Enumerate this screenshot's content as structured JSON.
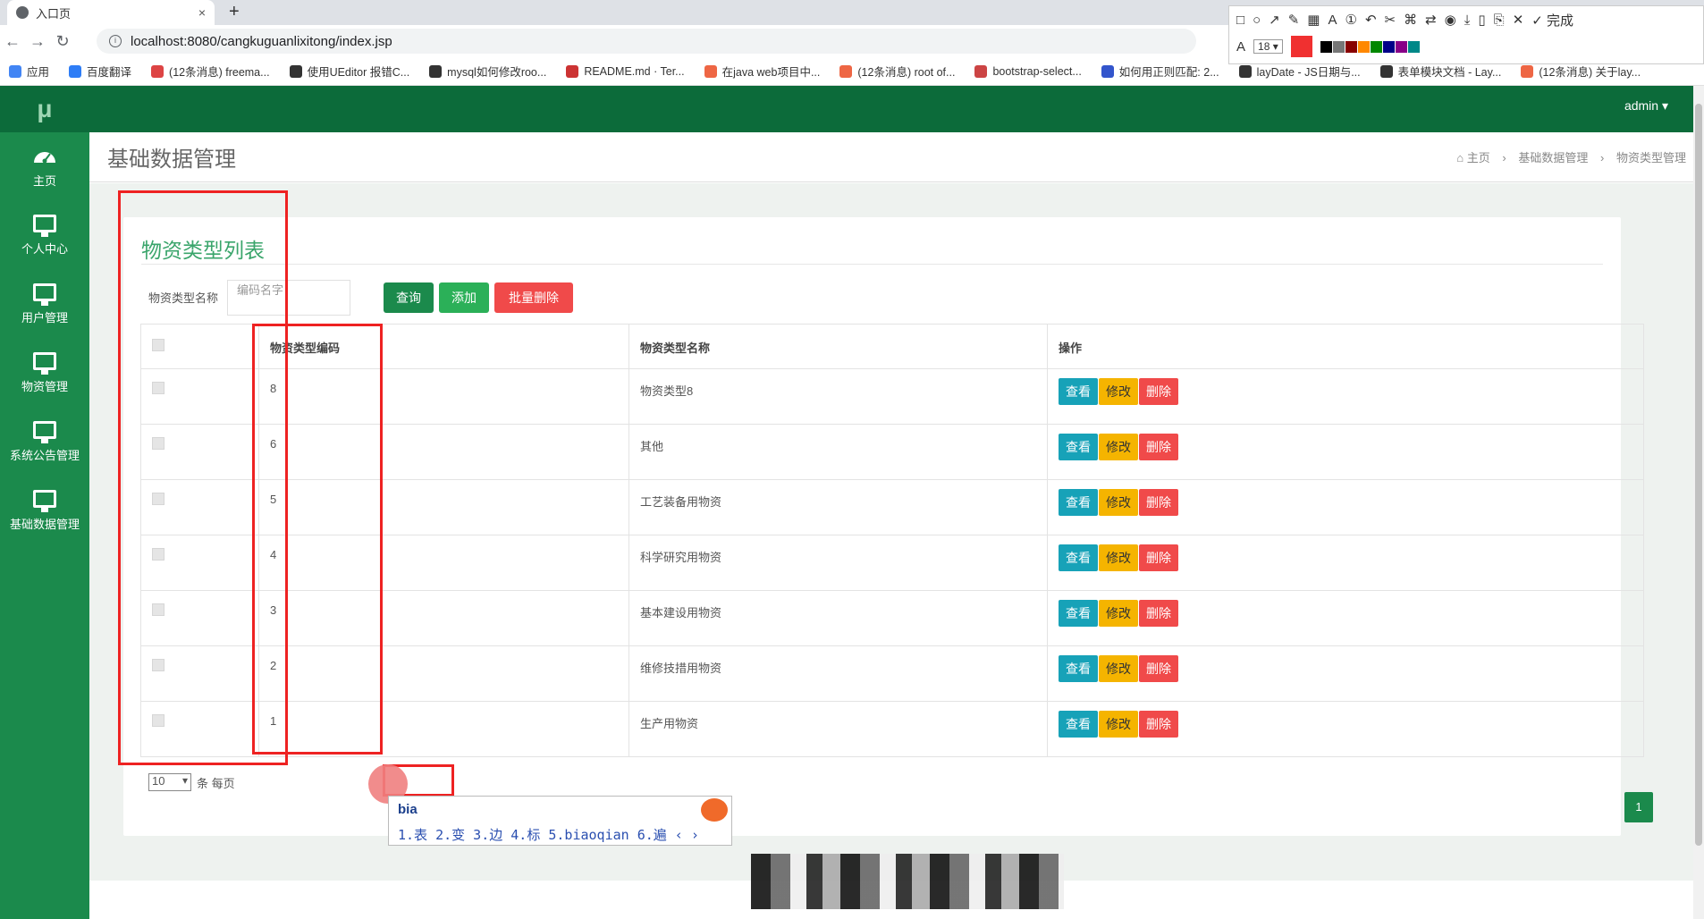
{
  "browser": {
    "tab_title": "入口页",
    "tab_close": "×",
    "new_tab": "+",
    "url": "localhost:8080/cangkuguanlixitong/index.jsp",
    "bookmarks": [
      "应用",
      "百度翻译",
      "(12条消息) freema...",
      "使用UEditor 报错C...",
      "mysql如何修改roo...",
      "README.md · Ter...",
      "在java web项目中...",
      "(12条消息) root of...",
      "bootstrap-select...",
      "如何用正则匹配: 2...",
      "layDate - JS日期与...",
      "表单模块文档 - Lay...",
      "(12条消息) 关于lay..."
    ]
  },
  "snaptool": {
    "font_size": "18",
    "done": "完成"
  },
  "app": {
    "logo": "μ",
    "user": "admin ▾",
    "nav": [
      "主页",
      "个人中心",
      "用户管理",
      "物资管理",
      "系统公告管理",
      "基础数据管理"
    ],
    "page_title": "基础数据管理",
    "breadcrumb": [
      "主页",
      "基础数据管理",
      "物资类型管理"
    ]
  },
  "card": {
    "title": "物资类型列表",
    "search_label": "物资类型名称",
    "search_placeholder": "编码名字",
    "btn_query": "查询",
    "btn_add": "添加",
    "btn_batch_delete": "批量删除"
  },
  "table": {
    "headers": [
      "物资类型编码",
      "物资类型名称",
      "操作"
    ],
    "rows": [
      {
        "code": "8",
        "name": "物资类型8"
      },
      {
        "code": "6",
        "name": "其他"
      },
      {
        "code": "5",
        "name": "工艺装备用物资"
      },
      {
        "code": "4",
        "name": "科学研究用物资"
      },
      {
        "code": "3",
        "name": "基本建设用物资"
      },
      {
        "code": "2",
        "name": "维修技措用物资"
      },
      {
        "code": "1",
        "name": "生产用物资"
      }
    ],
    "op_view": "查看",
    "op_edit": "修改",
    "op_delete": "删除"
  },
  "pagination": {
    "per_page_value": "10",
    "per_page_suffix": "条 每页",
    "current_page": "1"
  },
  "ime": {
    "code": "bia",
    "candidates": "1.表 2.变 3.边 4.标 5.biaoqian 6.遍 ‹ ›"
  }
}
